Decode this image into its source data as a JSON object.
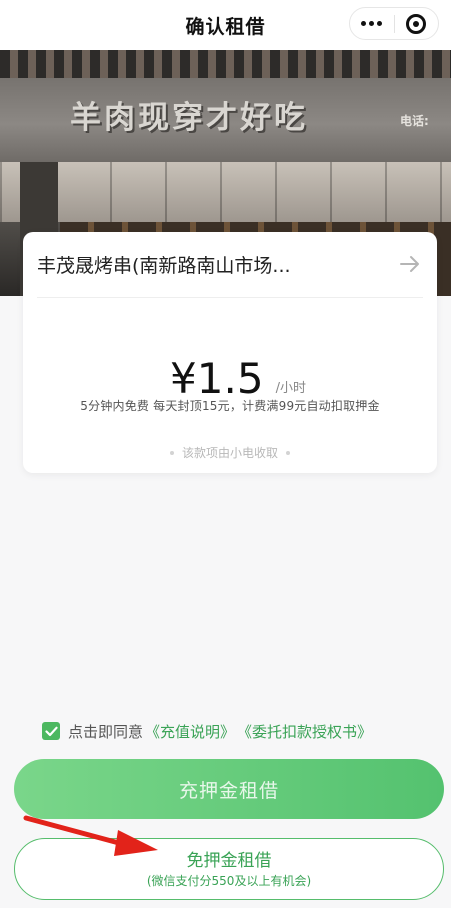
{
  "nav": {
    "title": "确认租借"
  },
  "hero": {
    "sign_text": "羊肉现穿才好吃",
    "sign_tel": "电话:"
  },
  "shop": {
    "name": "丰茂晟烤串(南新路南山市场..."
  },
  "pricing": {
    "price": "¥1.5",
    "unit": "/小时",
    "description": "5分钟内免费 每天封顶15元，计费满99元自动扣取押金",
    "collector_note": "该款项由小电收取"
  },
  "agreement": {
    "checked": true,
    "prefix": "点击即同意",
    "link_recharge": "《充值说明》",
    "link_authorization": "《委托扣款授权书》"
  },
  "buttons": {
    "deposit_rent": "充押金租借",
    "free_deposit_rent": "免押金租借",
    "free_deposit_note": "(微信支付分550及以上有机会)"
  },
  "colors": {
    "accent_green": "#3aa356",
    "button_gradient_start": "#7ad68a",
    "button_gradient_end": "#54c26f",
    "annotation_red": "#e2231a"
  }
}
